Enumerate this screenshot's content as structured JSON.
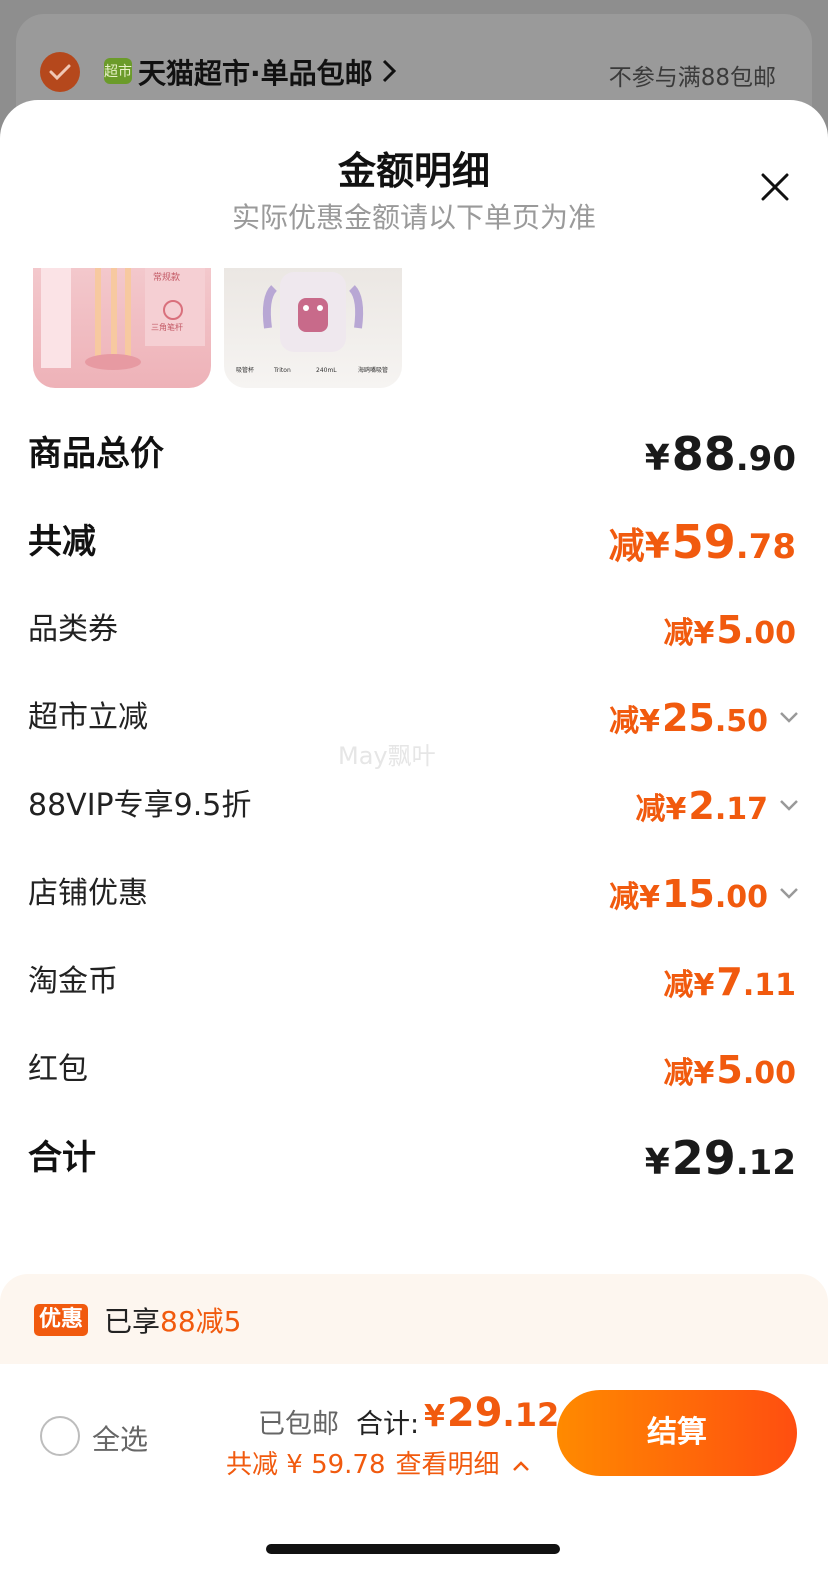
{
  "background": {
    "store_badge": "超市",
    "store_name": "天猫超市·单品包邮",
    "store_note": "不参与满88包邮"
  },
  "sheet": {
    "title": "金额明细",
    "subtitle": "实际优惠金额请以下单页为准",
    "close_icon": "close-icon"
  },
  "thumbnails": [
    {
      "label_top": "常规款",
      "label_bottom": "三角笔杆"
    },
    {
      "specs": [
        "吸管杯",
        "Triton",
        "240mL",
        "海鸥嘴吸管"
      ]
    }
  ],
  "rows": {
    "goods_total": {
      "label": "商品总价",
      "prefix": "",
      "currency": "¥",
      "int": "88",
      "dec": ".90"
    },
    "total_reduce": {
      "label": "共减",
      "prefix": "减",
      "currency": "¥",
      "int": "59",
      "dec": ".78"
    },
    "category_coupon": {
      "label": "品类券",
      "prefix": "减",
      "currency": "¥",
      "int": "5",
      "dec": ".00"
    },
    "market_discount": {
      "label": "超市立减",
      "prefix": "减",
      "currency": "¥",
      "int": "25",
      "dec": ".50"
    },
    "vip_discount": {
      "label": "88VIP专享9.5折",
      "prefix": "减",
      "currency": "¥",
      "int": "2",
      "dec": ".17"
    },
    "shop_discount": {
      "label": "店铺优惠",
      "prefix": "减",
      "currency": "¥",
      "int": "15",
      "dec": ".00"
    },
    "taojinbi": {
      "label": "淘金币",
      "prefix": "减",
      "currency": "¥",
      "int": "7",
      "dec": ".11"
    },
    "red_packet": {
      "label": "红包",
      "prefix": "减",
      "currency": "¥",
      "int": "5",
      "dec": ".00"
    },
    "sum": {
      "label": "合计",
      "prefix": "",
      "currency": "¥",
      "int": "29",
      "dec": ".12"
    }
  },
  "watermark": "May飘叶",
  "promo": {
    "tag": "优惠",
    "text": "已享",
    "highlight": "88减5"
  },
  "footer": {
    "select_all": "全选",
    "free_shipping": "已包邮",
    "total_label": "合计:",
    "total_currency": "¥",
    "total_int": "29",
    "total_dec": ".12",
    "saved_text": "共减 ¥ 59.78",
    "detail_link": "查看明细",
    "checkout": "结算"
  },
  "colors": {
    "accent": "#f15a0e",
    "checkout_start": "#ff8a00",
    "checkout_end": "#ff4e10"
  }
}
